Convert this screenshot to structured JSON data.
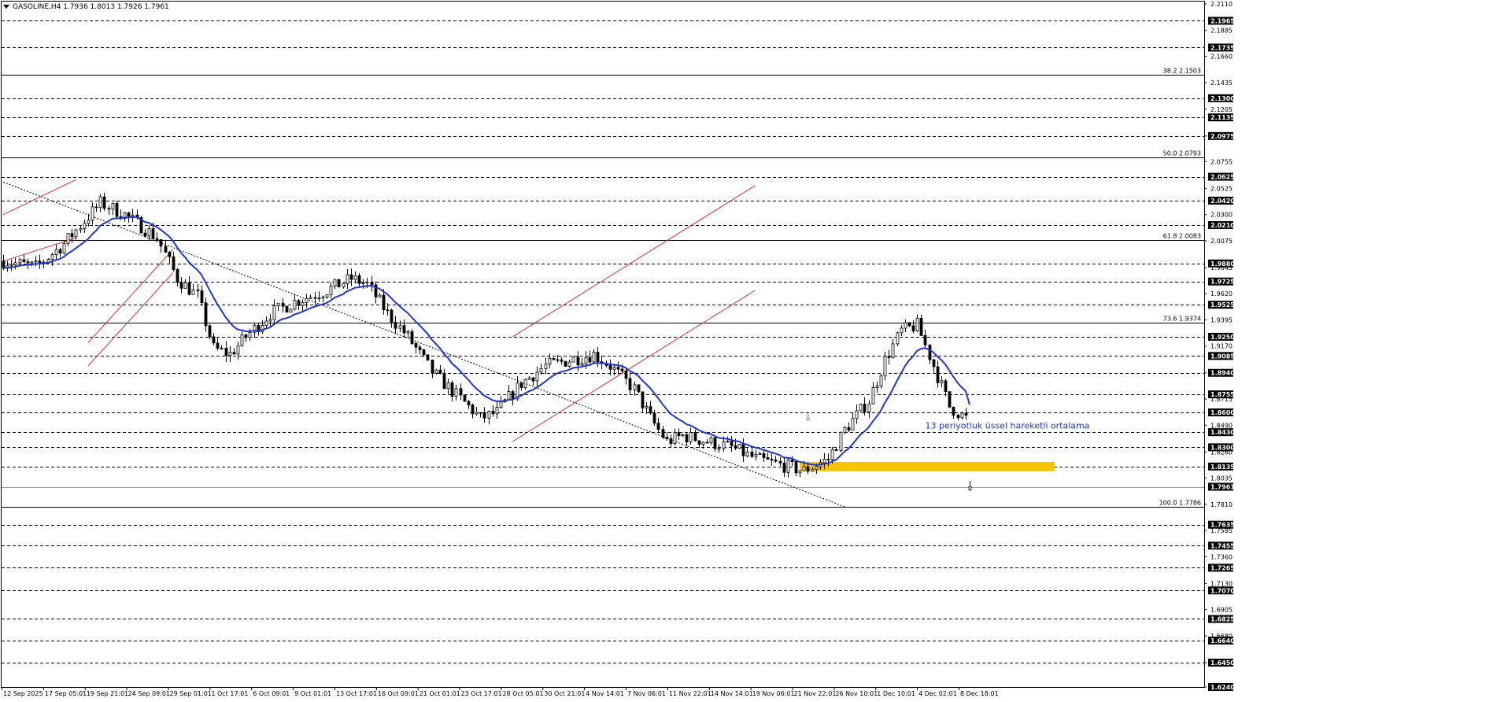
{
  "header": {
    "symbol_text": "GASOLINE,H4  1.7936 1.8013 1.7926 1.7961",
    "menu_icon": "triangle-down-icon"
  },
  "chart_data": {
    "type": "candlestick",
    "symbol": "GASOLINE",
    "timeframe": "H4",
    "ohlc_last": {
      "open": 1.7936,
      "high": 1.8013,
      "low": 1.7926,
      "close": 1.7961
    },
    "current_price": 1.7961,
    "ylim": [
      1.624,
      2.211
    ],
    "y_ticks": [
      "2.2110",
      "2.1885",
      "2.1660",
      "2.1435",
      "2.1205",
      "2.0975",
      "2.0755",
      "2.0525",
      "2.0300",
      "2.0075",
      "1.9845",
      "1.9620",
      "1.9395",
      "1.9170",
      "1.8940",
      "1.8715",
      "1.8490",
      "1.8260",
      "1.8035",
      "1.7810",
      "1.7585",
      "1.7360",
      "1.7130",
      "1.6905",
      "1.6680",
      "1.6450",
      "1.6240"
    ],
    "dashed_levels": [
      2.1965,
      2.1735,
      2.13,
      2.1135,
      2.0975,
      2.0625,
      2.042,
      2.021,
      1.988,
      1.9725,
      1.9525,
      1.925,
      1.9085,
      1.894,
      1.8755,
      1.86,
      1.843,
      1.83,
      1.8135,
      1.7635,
      1.7455,
      1.7265,
      1.707,
      1.6825,
      1.664,
      1.645,
      1.624
    ],
    "highlighted_labels": [
      "2.1965",
      "2.1735",
      "2.1300",
      "2.1135",
      "2.0975",
      "2.0625",
      "2.0420",
      "2.0210",
      "1.9880",
      "1.9725",
      "1.9525",
      "1.9250",
      "1.9085",
      "1.8940",
      "1.8755",
      "1.8600",
      "1.8430",
      "1.8300",
      "1.8135",
      "1.7961",
      "1.7635",
      "1.7455",
      "1.7265",
      "1.7070",
      "1.6825",
      "1.6640",
      "1.6450",
      "1.6240"
    ],
    "fibonacci": [
      {
        "label": "38.2 2.1503",
        "value": 2.1503
      },
      {
        "label": "50.0 2.0793",
        "value": 2.0793
      },
      {
        "label": "61.8 2.0083",
        "value": 2.0083
      },
      {
        "label": "73.6 1.9374",
        "value": 1.9374
      },
      {
        "label": "100.0 1.7786",
        "value": 1.7786
      }
    ],
    "x_labels": [
      "12 Sep 2025",
      "17 Sep 05:01",
      "19 Sep 21:01",
      "24 Sep 09:01",
      "29 Sep 01:01",
      "1 Oct 17:01",
      "6 Oct 09:01",
      "9 Oct 01:01",
      "13 Oct 17:01",
      "16 Oct 09:01",
      "21 Oct 01:01",
      "23 Oct 17:01",
      "28 Oct 05:01",
      "30 Oct 21:01",
      "4 Nov 14:01",
      "7 Nov 06:01",
      "11 Nov 22:01",
      "14 Nov 14:01",
      "19 Nov 06:01",
      "21 Nov 22:01",
      "26 Nov 10:01",
      "1 Dec 10:01",
      "4 Dec 02:01",
      "8 Dec 18:01"
    ],
    "candle_count": 240,
    "close_path": [
      [
        0,
        1.99
      ],
      [
        8,
        1.985
      ],
      [
        15,
        2.005
      ],
      [
        24,
        2.04
      ],
      [
        30,
        2.03
      ],
      [
        38,
        2.01
      ],
      [
        43,
        1.975
      ],
      [
        48,
        1.96
      ],
      [
        52,
        1.915
      ],
      [
        56,
        1.91
      ],
      [
        60,
        1.925
      ],
      [
        66,
        1.945
      ],
      [
        72,
        1.955
      ],
      [
        80,
        1.965
      ],
      [
        86,
        1.975
      ],
      [
        90,
        1.97
      ],
      [
        95,
        1.945
      ],
      [
        100,
        1.925
      ],
      [
        106,
        1.895
      ],
      [
        112,
        1.875
      ],
      [
        118,
        1.855
      ],
      [
        122,
        1.86
      ],
      [
        128,
        1.885
      ],
      [
        134,
        1.9
      ],
      [
        140,
        1.905
      ],
      [
        146,
        1.91
      ],
      [
        150,
        1.9
      ],
      [
        156,
        1.88
      ],
      [
        160,
        1.855
      ],
      [
        164,
        1.835
      ],
      [
        168,
        1.84
      ],
      [
        174,
        1.835
      ],
      [
        180,
        1.83
      ],
      [
        186,
        1.82
      ],
      [
        192,
        1.815
      ],
      [
        198,
        1.81
      ],
      [
        204,
        1.82
      ],
      [
        208,
        1.845
      ],
      [
        214,
        1.87
      ],
      [
        218,
        1.905
      ],
      [
        222,
        1.93
      ],
      [
        226,
        1.935
      ],
      [
        230,
        1.9
      ],
      [
        234,
        1.865
      ],
      [
        238,
        1.855
      ]
    ],
    "ema_label": "13 periyotluk üssel hareketli ortalama",
    "ema_period": 13,
    "support_zone": [
      1.8095,
      1.8175
    ],
    "sell_marker": "⇩",
    "colors": {
      "ema": "#1f35d8",
      "channel": "#d93030",
      "zone": "#f6c400",
      "candle": "#000000",
      "grid": "#000000"
    }
  }
}
